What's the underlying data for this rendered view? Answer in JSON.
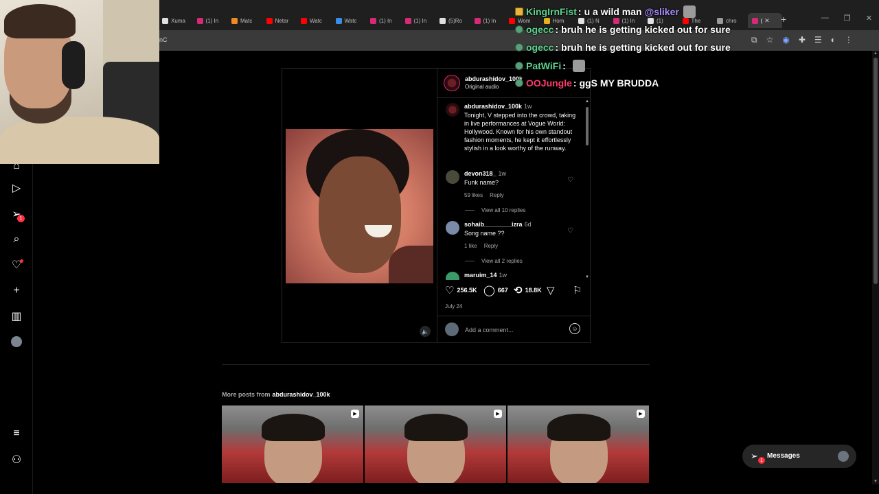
{
  "browser": {
    "tabs": [
      {
        "label": "Xuma",
        "color": "#e0e0e0"
      },
      {
        "label": "(1) In",
        "color": "#d62976"
      },
      {
        "label": "Matc",
        "color": "#f08a24"
      },
      {
        "label": "Netar",
        "color": "#ff0000"
      },
      {
        "label": "Watc",
        "color": "#ff0000"
      },
      {
        "label": "Watc",
        "color": "#3a8ee6"
      },
      {
        "label": "(1) In",
        "color": "#d62976"
      },
      {
        "label": "(1) In",
        "color": "#d62976"
      },
      {
        "label": "(5)Ro",
        "color": "#e0e0e0"
      },
      {
        "label": "(1) In",
        "color": "#d62976"
      },
      {
        "label": "Wom",
        "color": "#ff0000"
      },
      {
        "label": "Hom",
        "color": "#e6b020"
      },
      {
        "label": "(1) N",
        "color": "#e0e0e0"
      },
      {
        "label": "(1) In",
        "color": "#d62976"
      },
      {
        "label": "(1)",
        "color": "#e0e0e0"
      },
      {
        "label": "The",
        "color": "#ff0000"
      },
      {
        "label": "chro",
        "color": "#9a9a9a"
      },
      {
        "label": "(",
        "color": "#d62976",
        "active": true
      }
    ],
    "new_tab_icon": "plus-icon",
    "url_fragment": "nC"
  },
  "chat": [
    {
      "badge": "gold",
      "name": "KingIrnFist",
      "name_color": "#5fd38d",
      "text": "u a wild man",
      "mention": "@sliker",
      "emote": true
    },
    {
      "badge": "green",
      "name": "ogecc",
      "name_color": "#5fd38d",
      "text": "bruh he is getting kicked out for sure"
    },
    {
      "badge": "green",
      "name": "ogecc",
      "name_color": "#5fd38d",
      "text": "bruh he is getting kicked out for sure"
    },
    {
      "badge": "green",
      "name": "PatWiFi",
      "name_color": "#5fd38d",
      "text": "",
      "emote": true
    },
    {
      "badge": "green",
      "name": "OOJungle",
      "name_color": "#ff3a6a",
      "text": "ggS MY BRUDDA"
    }
  ],
  "nav": {
    "notifications_count": "1"
  },
  "post": {
    "author": "abdurashidov_100k",
    "audio": "Original audio",
    "caption": {
      "user": "abdurashidov_100k",
      "time": "1w",
      "text": "Tonight, V stepped into the crowd, taking in live performances at Vogue World: Hollywood. Known for his own standout fashion moments, he kept it effortlessly stylish in a look worthy of the runway."
    },
    "comments": [
      {
        "user": "devon318_",
        "time": "1w",
        "text": "Funk name?",
        "likes": "59 likes",
        "reply": "Reply",
        "replies": "View all 10 replies",
        "avatar_color": "#4a4a3a"
      },
      {
        "user": "sohaib________izra",
        "time": "6d",
        "text": "Song name ??",
        "likes": "1 like",
        "reply": "Reply",
        "replies": "View all 2 replies",
        "avatar_color": "#7a8aa8"
      },
      {
        "user": "maruim_14",
        "time": "1w",
        "text": "",
        "avatar_color": "#3a9a6a"
      }
    ],
    "likes": "256.5K",
    "comment_count": "667",
    "reposts": "18.8K",
    "date": "July 24",
    "comment_placeholder": "Add a comment..."
  },
  "more_posts": {
    "label": "More posts from",
    "user": "abdurashidov_100k",
    "count": 3
  },
  "messages": {
    "label": "Messages",
    "badge": "1"
  }
}
